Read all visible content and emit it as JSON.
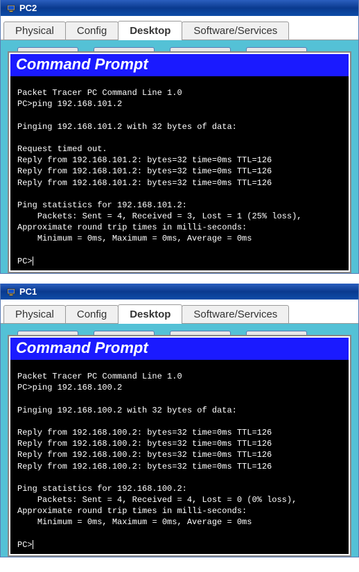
{
  "windows": [
    {
      "title": "PC2",
      "tabs": [
        "Physical",
        "Config",
        "Desktop",
        "Software/Services"
      ],
      "activeTab": "Desktop",
      "promptTitle": "Command Prompt",
      "terminal": {
        "header": "Packet Tracer PC Command Line 1.0",
        "cmd": "PC>ping 192.168.101.2",
        "pinging": "Pinging 192.168.101.2 with 32 bytes of data:",
        "lines": [
          "Request timed out.",
          "Reply from 192.168.101.2: bytes=32 time=0ms TTL=126",
          "Reply from 192.168.101.2: bytes=32 time=0ms TTL=126",
          "Reply from 192.168.101.2: bytes=32 time=0ms TTL=126"
        ],
        "statsHeader": "Ping statistics for 192.168.101.2:",
        "statsPackets": "    Packets: Sent = 4, Received = 3, Lost = 1 (25% loss),",
        "approx": "Approximate round trip times in milli-seconds:",
        "times": "    Minimum = 0ms, Maximum = 0ms, Average = 0ms",
        "prompt": "PC>"
      }
    },
    {
      "title": "PC1",
      "tabs": [
        "Physical",
        "Config",
        "Desktop",
        "Software/Services"
      ],
      "activeTab": "Desktop",
      "promptTitle": "Command Prompt",
      "terminal": {
        "header": "Packet Tracer PC Command Line 1.0",
        "cmd": "PC>ping 192.168.100.2",
        "pinging": "Pinging 192.168.100.2 with 32 bytes of data:",
        "lines": [
          "Reply from 192.168.100.2: bytes=32 time=0ms TTL=126",
          "Reply from 192.168.100.2: bytes=32 time=0ms TTL=126",
          "Reply from 192.168.100.2: bytes=32 time=0ms TTL=126",
          "Reply from 192.168.100.2: bytes=32 time=0ms TTL=126"
        ],
        "statsHeader": "Ping statistics for 192.168.100.2:",
        "statsPackets": "    Packets: Sent = 4, Received = 4, Lost = 0 (0% loss),",
        "approx": "Approximate round trip times in milli-seconds:",
        "times": "    Minimum = 0ms, Maximum = 0ms, Average = 0ms",
        "prompt": "PC>"
      }
    }
  ]
}
